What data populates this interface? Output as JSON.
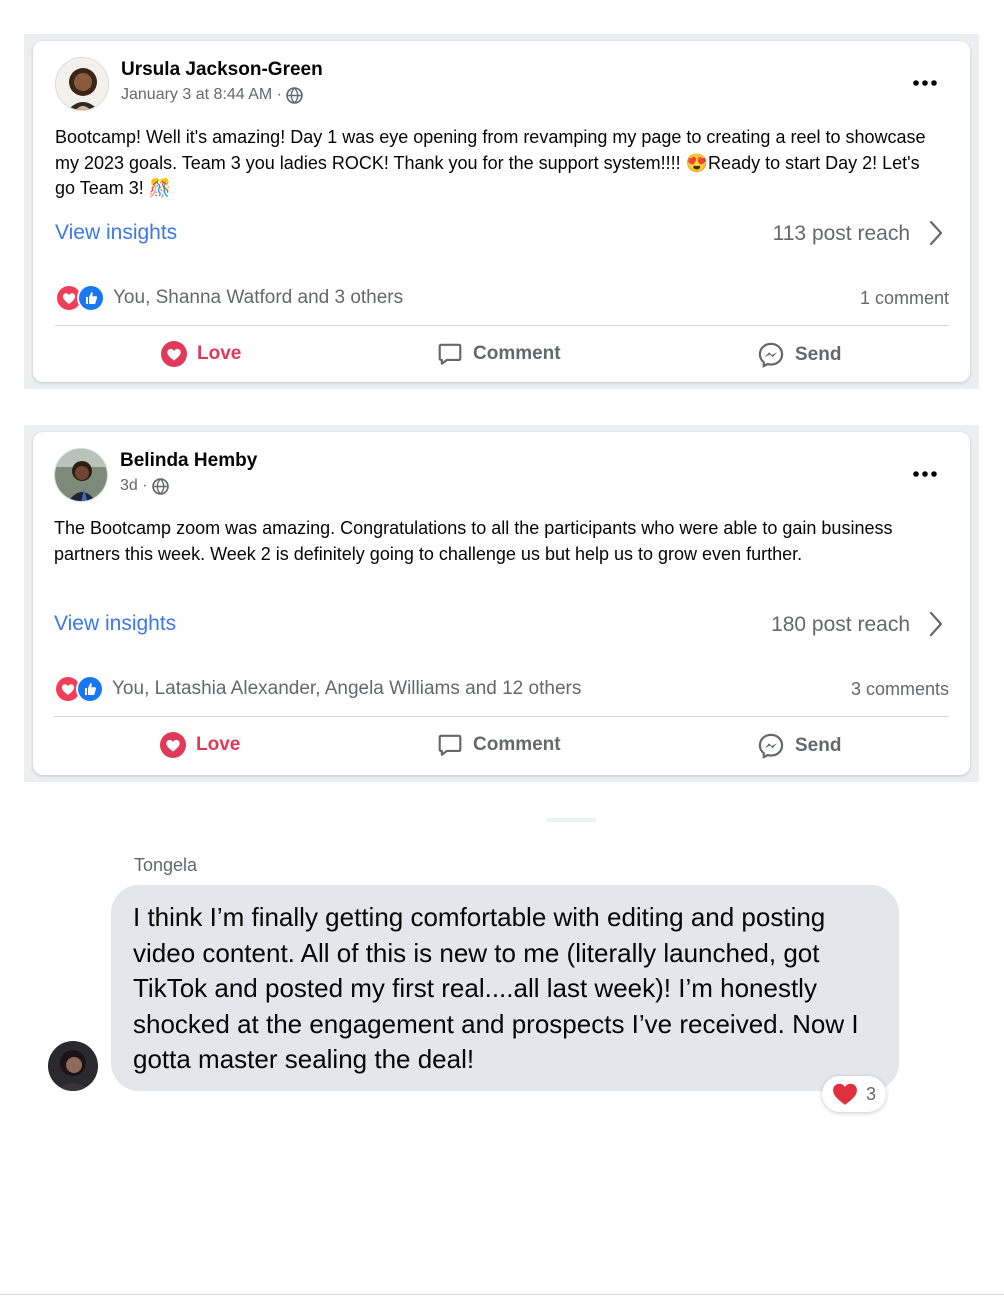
{
  "posts": [
    {
      "author": "Ursula Jackson-Green",
      "timestamp": "January 3 at 8:44 AM ·",
      "privacy_icon": "globe-icon",
      "text": "Bootcamp! Well it's amazing! Day 1 was eye opening from revamping my page to creating a reel to showcase my 2023 goals. Team 3 you ladies ROCK! Thank you for the support system!!!! 😍Ready to start Day 2! Let's go Team 3! 🎊",
      "insights_label": "View insights",
      "reach": "113 post reach",
      "reactions_text": "You, Shanna Watford and 3 others",
      "comments": "1 comment",
      "actions": {
        "love": "Love",
        "comment": "Comment",
        "send": "Send"
      }
    },
    {
      "author": "Belinda Hemby",
      "timestamp": "3d ·",
      "privacy_icon": "globe-icon",
      "text": "The Bootcamp zoom was amazing.  Congratulations to all the participants who were able to gain business partners this week. Week 2 is definitely going to challenge us but help us to grow even further.",
      "insights_label": "View insights",
      "reach": "180 post reach",
      "reactions_text": "You, Latashia Alexander, Angela Williams and 12 others",
      "comments": "3 comments",
      "actions": {
        "love": "Love",
        "comment": "Comment",
        "send": "Send"
      }
    }
  ],
  "message": {
    "sender": "Tongela",
    "text": "I think I’m finally getting comfortable with editing and posting video content. All of this is new to me (literally launched, got TikTok and posted my first real....all last week)! I’m honestly shocked at the engagement and prospects I’ve received. Now I gotta master sealing the deal!",
    "reaction_count": "3",
    "reaction_icon": "heart-icon"
  },
  "colors": {
    "link_blue": "#3b78e7",
    "love_red": "#e1395a",
    "like_blue": "#1877f2",
    "muted_text": "#65676b",
    "bubble_bg": "#e4e6eb"
  }
}
